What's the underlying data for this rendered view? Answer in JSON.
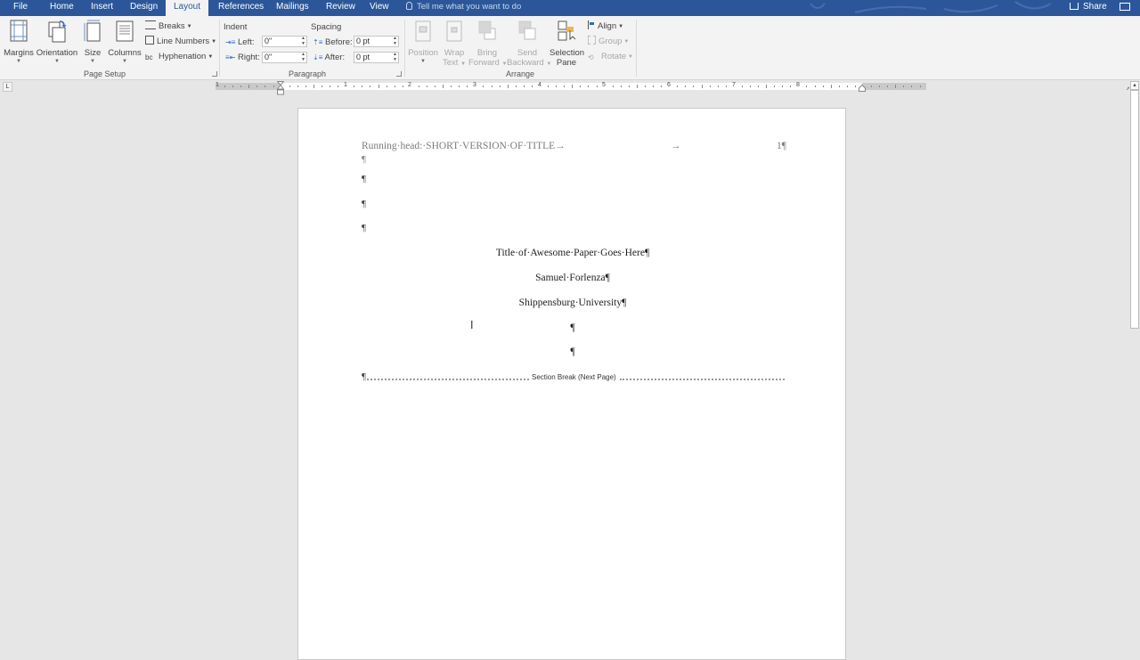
{
  "tabs": [
    "File",
    "Home",
    "Insert",
    "Design",
    "Layout",
    "References",
    "Mailings",
    "Review",
    "View"
  ],
  "active_tab": "Layout",
  "tell_me": "Tell me what you want to do",
  "share_label": "Share",
  "page_setup": {
    "group_label": "Page Setup",
    "margins": "Margins",
    "orientation": "Orientation",
    "size": "Size",
    "columns": "Columns",
    "breaks": "Breaks",
    "line_numbers": "Line Numbers",
    "hyphenation": "Hyphenation"
  },
  "paragraph": {
    "group_label": "Paragraph",
    "indent_label": "Indent",
    "spacing_label": "Spacing",
    "left_label": "Left:",
    "right_label": "Right:",
    "before_label": "Before:",
    "after_label": "After:",
    "left_value": "0\"",
    "right_value": "0\"",
    "before_value": "0 pt",
    "after_value": "0 pt"
  },
  "arrange": {
    "group_label": "Arrange",
    "position": "Position",
    "wrap_text_1": "Wrap",
    "wrap_text_2": "Text",
    "bring_forward_1": "Bring",
    "bring_forward_2": "Forward",
    "send_backward_1": "Send",
    "send_backward_2": "Backward",
    "selection_pane_1": "Selection",
    "selection_pane_2": "Pane",
    "align": "Align",
    "group": "Group",
    "rotate": "Rotate"
  },
  "ruler": {
    "tab_selector": "L",
    "numbers": [
      "1",
      "1",
      "2",
      "3",
      "4",
      "5",
      "6",
      "7",
      "8"
    ]
  },
  "document": {
    "running_head": "Running·head:·SHORT·VERSION·OF·TITLE→",
    "tab_arrow": "→",
    "page_number": "1¶",
    "pilcrow": "¶",
    "title": "Title·of·Awesome·Paper·Goes·Here¶",
    "author": "Samuel·Forlenza¶",
    "institution": "Shippensburg·University¶",
    "section_break": "Section Break (Next Page)",
    "cursor": "I"
  }
}
